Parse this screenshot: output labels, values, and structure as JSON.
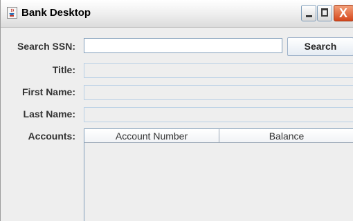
{
  "window": {
    "title": "Bank Desktop",
    "app_icon": "java-cup-icon",
    "controls": {
      "minimize": "minimize-icon",
      "maximize": "maximize-icon",
      "close_glyph": "X"
    }
  },
  "form": {
    "search_ssn_label": "Search SSN:",
    "search_ssn_value": "",
    "search_button_label": "Search",
    "title_label": "Title:",
    "title_value": "",
    "first_name_label": "First Name:",
    "first_name_value": "",
    "last_name_label": "Last Name:",
    "last_name_value": "",
    "accounts_label": "Accounts:"
  },
  "accounts_table": {
    "columns": [
      "Account Number",
      "Balance"
    ],
    "rows": []
  }
}
